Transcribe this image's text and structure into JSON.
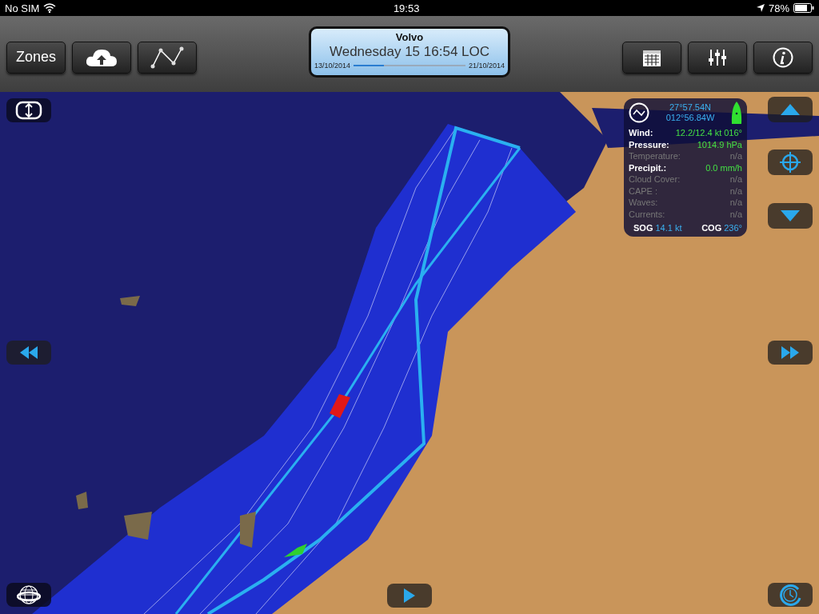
{
  "status_bar": {
    "carrier": "No SIM",
    "time": "19:53",
    "battery": "78%"
  },
  "toolbar": {
    "left_buttons": [
      {
        "kind": "text",
        "label": "Zones"
      },
      {
        "kind": "cloud"
      },
      {
        "kind": "route"
      }
    ],
    "right_buttons": [
      {
        "kind": "calendar"
      },
      {
        "kind": "sliders"
      },
      {
        "kind": "info"
      }
    ]
  },
  "timeline": {
    "title": "Volvo",
    "datetime": "Wednesday 15 16:54 LOC",
    "start": "13/10/2014",
    "end": "21/10/2014",
    "level": 0.27
  },
  "info_panel": {
    "lat": "27°57.54N",
    "lon": "012°56.84W",
    "rows": [
      {
        "label": "Wind:",
        "value": "12.2/12.4 kt 016°",
        "available": true
      },
      {
        "label": "Pressure:",
        "value": "1014.9 hPa",
        "available": true
      },
      {
        "label": "Temperature:",
        "value": "n/a",
        "available": false
      },
      {
        "label": "Precipit.:",
        "value": "0.0 mm/h",
        "available": true
      },
      {
        "label": "Cloud Cover:",
        "value": "n/a",
        "available": false
      },
      {
        "label": "CAPE :",
        "value": "n/a",
        "available": false
      },
      {
        "label": "Waves:",
        "value": "n/a",
        "available": false
      },
      {
        "label": "Currents:",
        "value": "n/a",
        "available": false
      }
    ],
    "sog_label": "SOG",
    "sog": "14.1 kt",
    "cog_label": "COG",
    "cog": "236°"
  }
}
